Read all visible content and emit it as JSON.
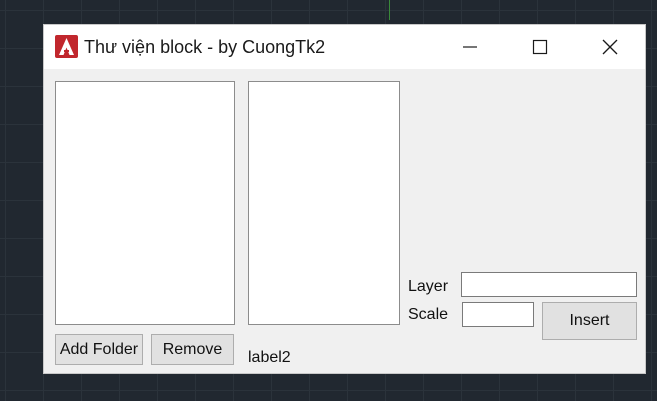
{
  "window": {
    "title": "Thư viện block - by CuongTk2",
    "icons": {
      "app": "autocad-logo-icon",
      "minimize": "minimize-icon",
      "maximize": "maximize-icon",
      "close": "close-icon"
    }
  },
  "buttons": {
    "add_folder": "Add Folder",
    "remove": "Remove",
    "insert": "Insert"
  },
  "labels": {
    "layer": "Layer",
    "scale": "Scale",
    "label2": "label2"
  },
  "inputs": {
    "layer_value": "",
    "scale_value": ""
  },
  "colors": {
    "brand_red": "#c1272d",
    "window_bg": "#f0f0f0"
  }
}
